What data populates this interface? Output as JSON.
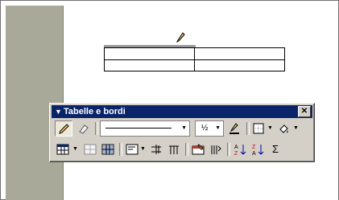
{
  "toolbar": {
    "title": "Tabelle e bordi",
    "close_glyph": "✕",
    "line_width": "½",
    "autosum_glyph": "Σ",
    "menu_arrow": "▼",
    "icons": [
      "draw-table-icon",
      "eraser-icon",
      "line-style-dropdown",
      "line-width-dropdown",
      "border-color-icon",
      "outside-border-icon",
      "shading-color-icon",
      "insert-table-icon",
      "merge-cells-icon",
      "split-cells-icon",
      "align-icon",
      "distribute-rows-icon",
      "distribute-columns-icon",
      "table-autoformat-icon",
      "change-text-direction-icon",
      "sort-ascending-icon",
      "sort-descending-icon",
      "autosum-icon"
    ]
  }
}
